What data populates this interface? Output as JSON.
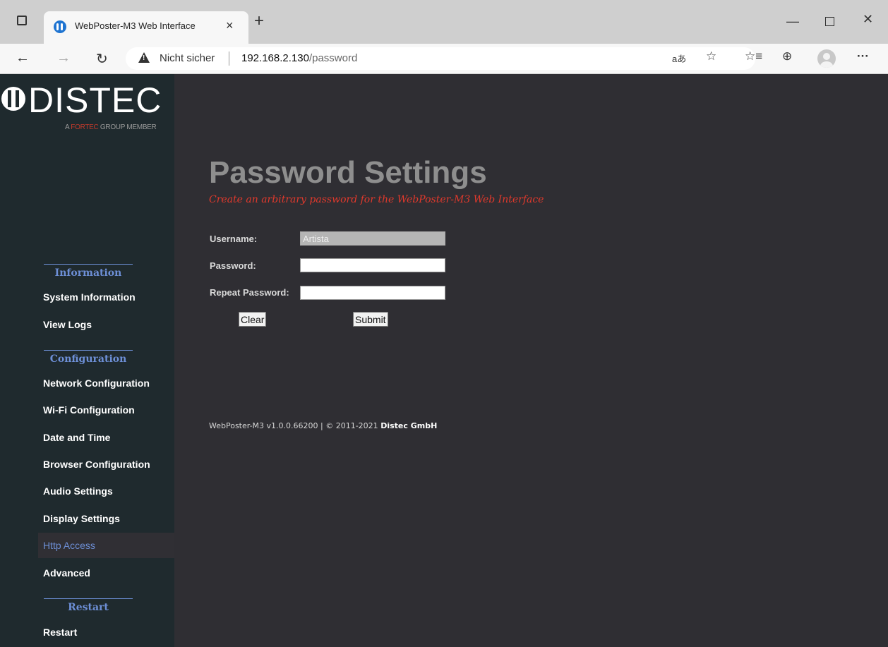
{
  "browser": {
    "tab_title": "WebPoster-M3 Web Interface",
    "tab_close": "×",
    "new_tab": "+",
    "not_secure": "Nicht sicher",
    "url_host": "192.168.2.130",
    "url_path": "/password",
    "icons": [
      "tab-actions-icon",
      "back-icon",
      "forward-icon",
      "refresh-icon",
      "warning-icon",
      "read-aloud-icon",
      "add-favorite-icon",
      "favorites-icon",
      "collections-icon",
      "profile-icon",
      "more-icon",
      "minimize-icon",
      "maximize-icon",
      "close-icon"
    ]
  },
  "logo": {
    "name": "DISTEC",
    "tagline_prefix": "A ",
    "tagline_accent": "FORTEC",
    "tagline_suffix": " GROUP MEMBER"
  },
  "sidebar": {
    "sections": [
      {
        "title": "Information",
        "items": [
          "System Information",
          "View Logs"
        ]
      },
      {
        "title": "Configuration",
        "items": [
          "Network Configuration",
          "Wi-Fi Configuration",
          "Date and Time",
          "Browser Configuration",
          "Audio Settings",
          "Display Settings",
          "Http Access",
          "Advanced"
        ]
      },
      {
        "title": "Restart",
        "items": [
          "Restart"
        ]
      }
    ],
    "active_item": "Http Access"
  },
  "main": {
    "title": "Password Settings",
    "subtitle": "Create an arbitrary password for the WebPoster-M3 Web Interface",
    "form": {
      "username_label": "Username:",
      "username_value": "Artista",
      "password_label": "Password:",
      "password_value": "",
      "repeat_label": "Repeat Password:",
      "repeat_value": "",
      "clear_label": "Clear",
      "submit_label": "Submit"
    },
    "footer": {
      "version_text": "WebPoster-M3 v1.0.0.66200 | © 2011-2021 ",
      "company": "Distec GmbH"
    }
  }
}
